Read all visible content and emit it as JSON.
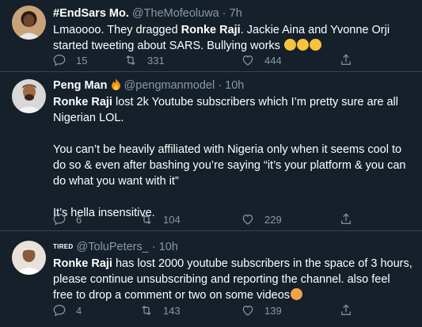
{
  "tweets": [
    {
      "name": "#EndSars Mo.",
      "handle": "@TheMofeoluwa",
      "separator": "·",
      "time": "7h",
      "body_parts": [
        "Lmaoooo. They dragged ",
        "Ronke Raji",
        ". Jackie Aina and Yvonne Orji started tweeting about SARS. Bullying works "
      ],
      "emojis": [
        "loudly-crying-face",
        "loudly-crying-face",
        "loudly-crying-face"
      ],
      "replies": "15",
      "retweets": "331",
      "likes": "444"
    },
    {
      "name": "Peng Man",
      "name_emoji": "fire",
      "handle": "@pengmanmodel",
      "separator": "·",
      "time": "10h",
      "p1_bold": "Ronke Raji",
      "p1_rest": " lost 2k Youtube subscribers which I’m pretty sure are all Nigerian LOL.",
      "p2": "You can’t be heavily affiliated with Nigeria only when it seems cool to do so & even after bashing you’re saying “it’s your platform & you can do what you want with it”",
      "p3": "It’s hella insensitive.",
      "replies": "6",
      "retweets": "104",
      "likes": "229"
    },
    {
      "name": "TIRED",
      "handle": "@ToluPeters_",
      "separator": "·",
      "time": "10h",
      "body_bold": "Ronke Raji",
      "body_rest": " has lost 2000 youtube subscribers in the space of 3 hours, please continue unsubscribing and reporting the channel. also feel free to drop a comment or two on some videos",
      "emoji": "smiling-face",
      "replies": "4",
      "retweets": "143",
      "likes": "139"
    }
  ],
  "colors": {
    "background": "#15202b",
    "divider": "#38444d",
    "secondary_text": "#8899a6"
  },
  "icons": [
    "reply-icon",
    "retweet-icon",
    "like-icon",
    "share-icon"
  ]
}
